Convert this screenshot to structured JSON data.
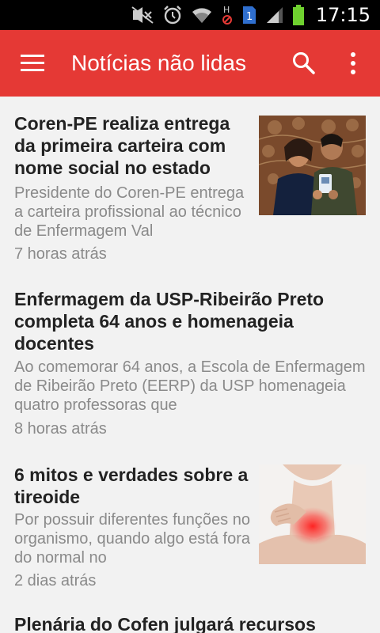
{
  "status_bar": {
    "time": "17:15",
    "icons": [
      "mute-icon",
      "alarm-icon",
      "wifi-icon",
      "hsdpa-icon",
      "sim-1-icon",
      "signal-icon",
      "battery-icon"
    ],
    "sim_label": "1",
    "network_label": "H"
  },
  "toolbar": {
    "title": "Notícias não lidas",
    "menu_icon": "menu-icon",
    "search_icon": "search-icon",
    "more_icon": "more-vert-icon",
    "color": "#e53935"
  },
  "articles": [
    {
      "title": "Coren-PE realiza entrega da primeira carteira com nome social no estado",
      "summary": "Presidente do Coren-PE entrega a carteira profissional ao técnico de Enfermagem Val",
      "time": "7 horas atrás",
      "has_image": true,
      "image": "two-people-holding-card-photo"
    },
    {
      "title": "Enfermagem da USP-Ribeirão Preto completa 64 anos e homenageia docentes",
      "summary": "Ao comemorar 64 anos, a Escola de Enfermagem de Ribeirão Preto (EERP) da USP homenageia quatro professoras que",
      "time": "8 horas atrás",
      "has_image": false
    },
    {
      "title": " 6 mitos e verdades sobre a tireoide",
      "summary": "Por possuir diferentes funções no organismo, quando algo está fora do normal no",
      "time": "2 dias atrás",
      "has_image": true,
      "image": "neck-thyroid-photo"
    },
    {
      "title": "Plenária do Cofen julgará recursos",
      "summary": "",
      "time": "",
      "has_image": false
    }
  ]
}
